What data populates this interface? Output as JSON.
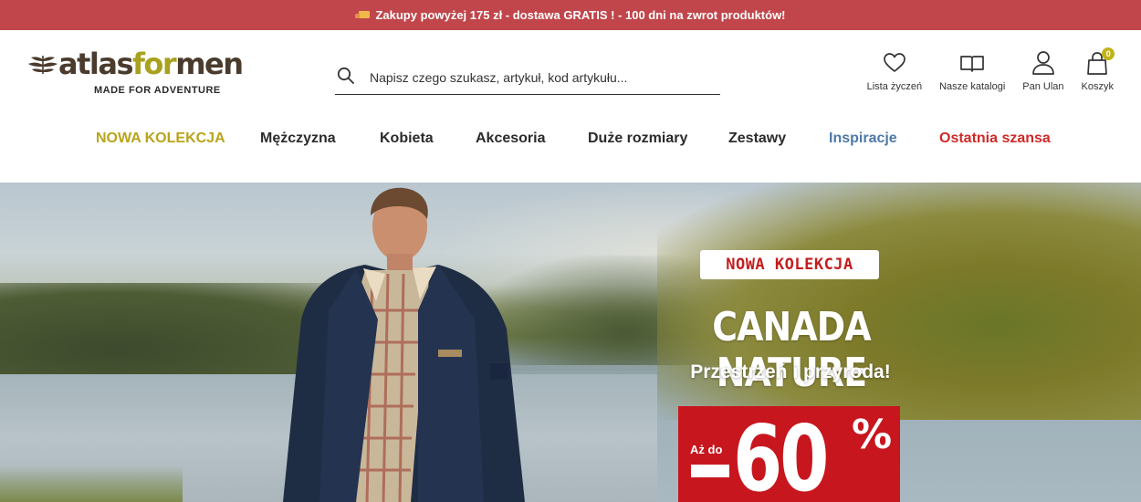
{
  "announcement": {
    "text": "Zakupy powyżej 175 zł - dostawa GRATIS ! - 100 dni na zwrot produktów!",
    "icon": "truck-icon"
  },
  "logo": {
    "word_a": "atlas",
    "word_b": "for",
    "word_c": "men",
    "tagline": "MADE FOR ADVENTURE"
  },
  "search": {
    "placeholder": "Napisz czego szukasz, artykuł, kod artykułu...",
    "value": ""
  },
  "tools": {
    "wishlist": "Lista życzeń",
    "catalogs": "Nasze katalogi",
    "account": "Pan Ulan",
    "cart": "Koszyk",
    "cart_count": "0"
  },
  "nav": {
    "items": [
      {
        "label": "NOWA KOLEKCJA"
      },
      {
        "label": "Mężczyzna"
      },
      {
        "label": "Kobieta"
      },
      {
        "label": "Akcesoria"
      },
      {
        "label": "Duże rozmiary"
      },
      {
        "label": "Zestawy"
      },
      {
        "label": "Inspiracje"
      },
      {
        "label": "Ostatnia szansa"
      }
    ]
  },
  "hero": {
    "badge": "NOWA KOLEKCJA",
    "title": "CANADA NATURE",
    "subtitle": "Przestrzeń i przyroda!",
    "promo_prefix": "Aż do",
    "promo_value": "60",
    "promo_unit": "%"
  },
  "colors": {
    "announcement_bg": "#c0464b",
    "accent": "#b9a41b",
    "inspiration": "#4e79a9",
    "sale": "#d02929",
    "promo_bg": "#c8161e"
  }
}
